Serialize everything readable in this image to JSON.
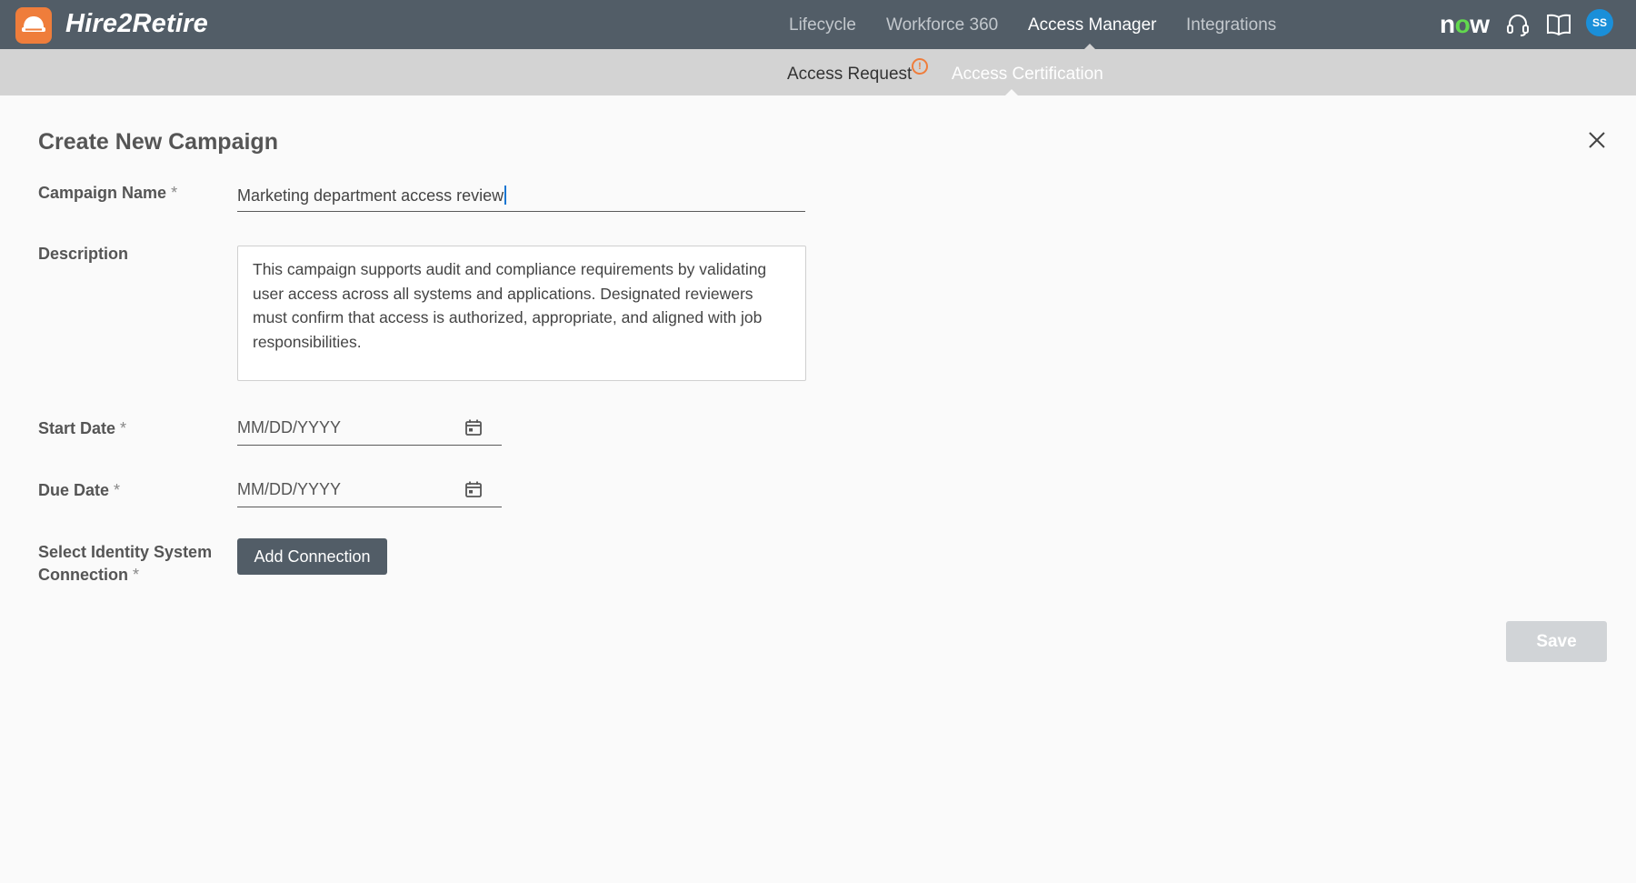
{
  "app": {
    "brand": "Hire2Retire",
    "nav": [
      {
        "label": "Lifecycle",
        "active": false
      },
      {
        "label": "Workforce 360",
        "active": false
      },
      {
        "label": "Access Manager",
        "active": true
      },
      {
        "label": "Integrations",
        "active": false
      }
    ],
    "partner_logo": {
      "prefix": "n",
      "o": "o",
      "suffix": "w"
    },
    "user_initials": "SS",
    "icons": [
      "headset-icon",
      "book-icon"
    ]
  },
  "subnav": {
    "items": [
      {
        "label": "Access Request",
        "alert_badge": "!"
      },
      {
        "label": "Access Certification",
        "active": true
      }
    ]
  },
  "form": {
    "title": "Create New Campaign",
    "required_mark": "*",
    "campaign_name": {
      "label": "Campaign Name",
      "value": "Marketing department access review"
    },
    "description": {
      "label": "Description",
      "value": "This campaign supports audit and compliance requirements by validating user access across all systems and applications. Designated reviewers must confirm that access is authorized, appropriate, and aligned with job responsibilities."
    },
    "start_date": {
      "label": "Start Date",
      "placeholder": "MM/DD/YYYY"
    },
    "due_date": {
      "label": "Due Date",
      "placeholder": "MM/DD/YYYY"
    },
    "identity_connection": {
      "label_line1": "Select Identity System",
      "label_line2": "Connection",
      "button_label": "Add Connection"
    },
    "save_label": "Save",
    "save_enabled": false
  },
  "colors": {
    "topbar": "#525d67",
    "subbar": "#d3d3d3",
    "accent_orange": "#ef7d3b",
    "avatar_blue": "#1a8fd9",
    "now_green": "#62d84e"
  }
}
